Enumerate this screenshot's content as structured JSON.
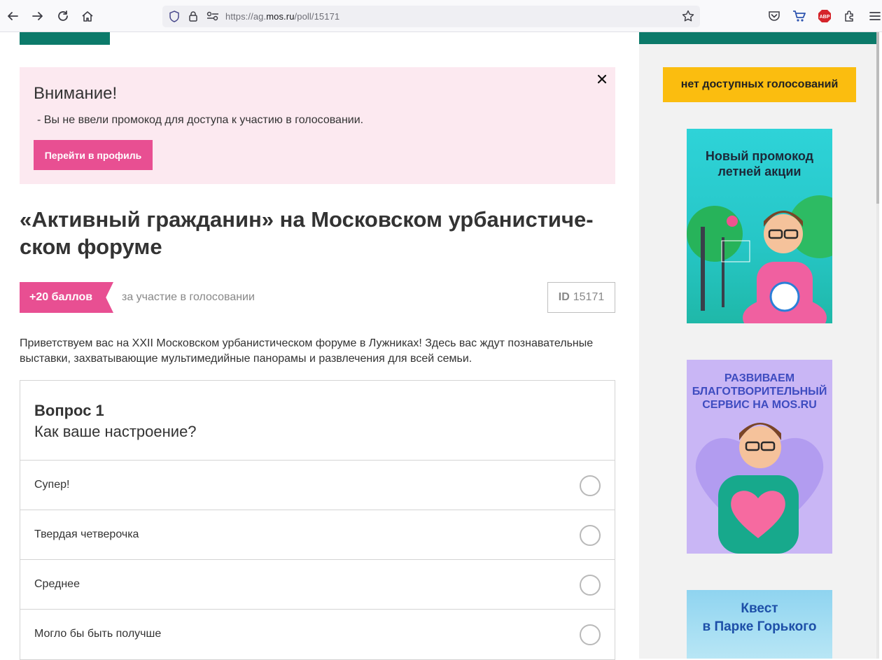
{
  "browser": {
    "url_prefix": "https://ag.",
    "url_domain": "mos.ru",
    "url_path": "/poll/15171",
    "abp_label": "ABP"
  },
  "alert": {
    "title": "Внимание!",
    "text": "- Вы не ввели промокод для доступа к участию в голосовании.",
    "button_label": "Перейти в профиль",
    "close_glyph": "✕"
  },
  "poll": {
    "title": "«Активный гражданин» на Московском урбанистиче-ском форуме",
    "title_line1": "«Активный гражданин» на Московском урбанистиче-",
    "title_line2": "ском форуме",
    "points_label": "+20 баллов",
    "points_caption": "за участие в голосовании",
    "id_label": "ID",
    "id_value": "15171",
    "intro": "Приветствуем вас на XXII Московском урбанистическом форуме в Лужниках! Здесь вас ждут познавательные выставки, захватывающие мультимедийные панорамы и развлечения для всей семьи."
  },
  "question": {
    "number": "Вопрос 1",
    "text": "Как ваше настроение?",
    "options": [
      "Супер!",
      "Твердая четверочка",
      "Среднее",
      "Могло бы быть получше"
    ]
  },
  "sidebar": {
    "no_votes_label": "нет доступных голосований",
    "banners": [
      {
        "title_line1": "Новый промокод",
        "title_line2": "летней акции"
      },
      {
        "title_line1": "РАЗВИВАЕМ",
        "title_line2": "БЛАГОТВОРИТЕЛЬНЫЙ",
        "title_line3": "СЕРВИС НА MOS.RU"
      },
      {
        "title_line1": "Квест",
        "title_line2": "в Парке Горького"
      }
    ]
  },
  "colors": {
    "teal": "#0c7a6a",
    "pink": "#e84f92",
    "alert_bg": "#fce9f0",
    "yellow": "#fbbd0f"
  }
}
